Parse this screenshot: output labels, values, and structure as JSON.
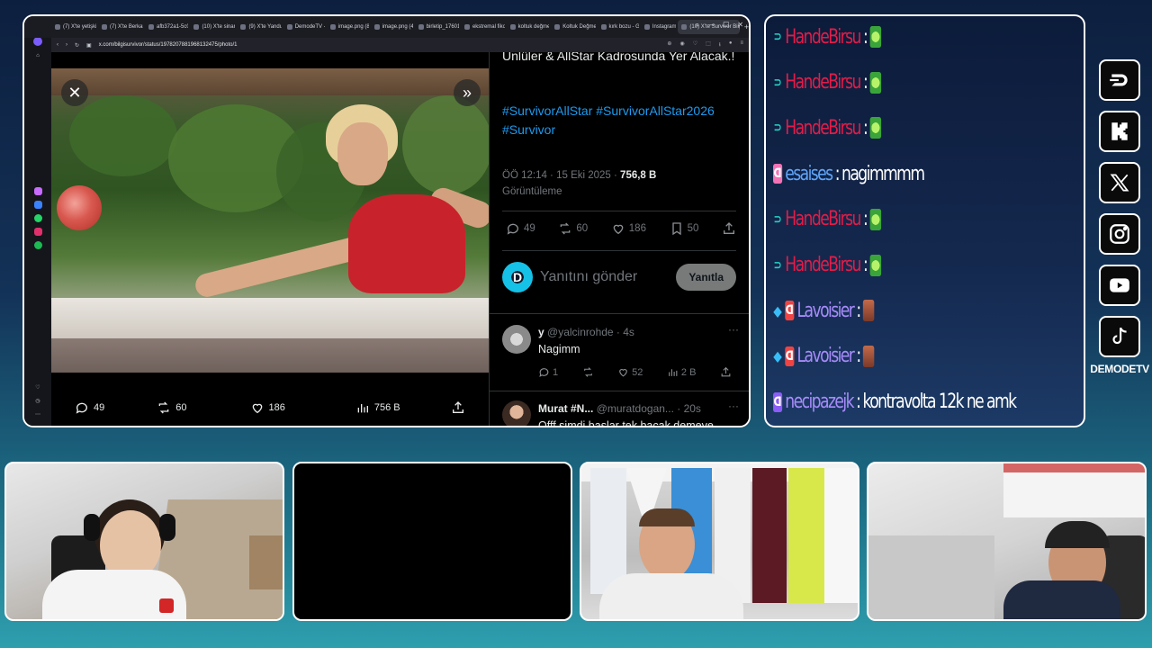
{
  "browser": {
    "tabs": [
      {
        "label": "(7) X'te yetişkin"
      },
      {
        "label": "(7) X'te Berkan"
      },
      {
        "label": "afb372a1-5c0"
      },
      {
        "label": "(10) X'te sinan"
      },
      {
        "label": "(9) X'te Yandu"
      },
      {
        "label": "DemodeTV -"
      },
      {
        "label": "image.png (8"
      },
      {
        "label": "image.png (4"
      },
      {
        "label": "birletip_17601"
      },
      {
        "label": "ekstremal fiko"
      },
      {
        "label": "koltuk değme"
      },
      {
        "label": "Koltuk Değme"
      },
      {
        "label": "kırk bozu - G"
      },
      {
        "label": "Instagram"
      },
      {
        "label": "(10) X'te Survivor Bilgi"
      }
    ],
    "address": "x.com/bilgisurvivor/status/1978207881968132475/photo/1"
  },
  "media_actions": {
    "replies": "49",
    "reposts": "60",
    "likes": "186",
    "views": "756 B"
  },
  "tweet": {
    "text": "Ünlüler & AllStar Kadrosunda Yer Alacak.!",
    "hashtags": "#SurvivorAllStar #SurvivorAllStar2026 #Survivor",
    "time": "ÖÖ 12:14 · 15 Eki 2025 · ",
    "views_count": "756,8 B",
    "views_label": "Görüntüleme",
    "stats": {
      "replies": "49",
      "reposts": "60",
      "likes": "186",
      "bookmarks": "50"
    },
    "reply_placeholder": "Yanıtını gönder",
    "reply_button": "Yanıtla"
  },
  "replies": [
    {
      "name": "y",
      "handle": "@yalcinrohde · 4s",
      "text": "Nagimm",
      "actions": {
        "replies": "1",
        "likes": "52",
        "views": "2 B"
      }
    },
    {
      "name": "Murat #N...",
      "handle": "@muratdogan... · 20s",
      "text": "Offf şimdi başlar tek bacak demeye"
    }
  ],
  "chat": [
    {
      "user": "HandeBirsu",
      "color": "#e11d48",
      "badge": "teal",
      "text": ""
    },
    {
      "user": "HandeBirsu",
      "color": "#e11d48",
      "badge": "teal",
      "text": ""
    },
    {
      "user": "HandeBirsu",
      "color": "#e11d48",
      "badge": "teal",
      "text": ""
    },
    {
      "user": "esaises",
      "color": "#60a5fa",
      "badge": "pink",
      "text": "nagimmmm"
    },
    {
      "user": "HandeBirsu",
      "color": "#e11d48",
      "badge": "teal",
      "text": ""
    },
    {
      "user": "HandeBirsu",
      "color": "#e11d48",
      "badge": "teal",
      "text": ""
    },
    {
      "user": "Lavoisier",
      "color": "#a78bfa",
      "badge": "cyan-red",
      "text": ""
    },
    {
      "user": "Lavoisier",
      "color": "#a78bfa",
      "badge": "cyan-red",
      "text": ""
    },
    {
      "user": "necipazejk",
      "color": "#a78bfa",
      "badge": "purple",
      "text": "kontravolta 12k ne amk"
    }
  ],
  "socials": {
    "items": [
      "demode-logo",
      "kick",
      "x",
      "instagram",
      "youtube",
      "tiktok"
    ],
    "channel_name": "DEMODETV"
  }
}
